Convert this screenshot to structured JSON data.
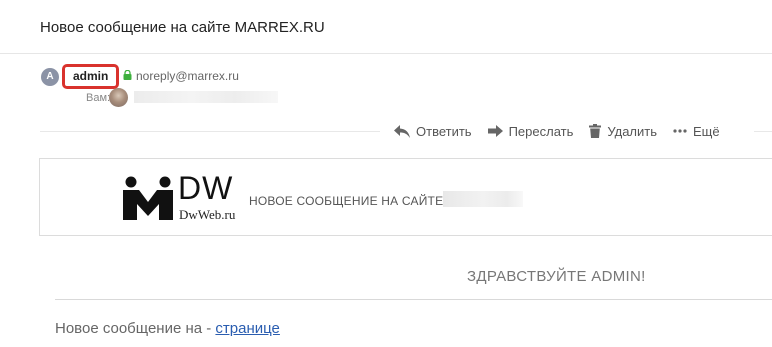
{
  "message": {
    "subject": "Новое сообщение на сайте MARREX.RU"
  },
  "sender": {
    "avatar_letter": "A",
    "name": "admin",
    "email": "noreply@marrex.ru"
  },
  "recipient": {
    "label": "Вам:",
    "value_hidden": true
  },
  "actions": [
    {
      "label": "Ответить",
      "icon": "reply-icon"
    },
    {
      "label": "Переслать",
      "icon": "forward-icon"
    },
    {
      "label": "Удалить",
      "icon": "trash-icon"
    },
    {
      "label": "Ещё",
      "icon": "more-dots-icon"
    }
  ],
  "email_body": {
    "brand": "DW",
    "brand_site": "DwWeb.ru",
    "header_title": "НОВОЕ СООБЩЕНИЕ НА САЙТЕ",
    "greeting": "ЗДРАВСТВУЙТЕ ADMIN!",
    "text_prefix": "Новое сообщение на - ",
    "link_text": "странице"
  },
  "colors": {
    "highlight_border": "#d9322d",
    "link": "#2a5db0",
    "lock": "#3db03d"
  }
}
